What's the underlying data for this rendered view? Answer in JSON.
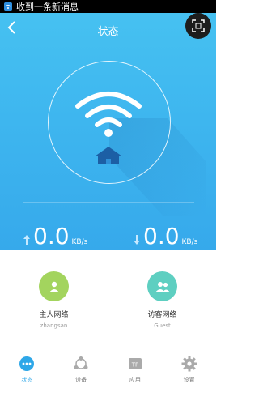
{
  "statusbar": {
    "notification": "收到一条新消息"
  },
  "header": {
    "title": "状态"
  },
  "speed": {
    "upload": {
      "value": "0.0",
      "unit": "KB/s"
    },
    "download": {
      "value": "0.0",
      "unit": "KB/s"
    }
  },
  "networks": [
    {
      "label": "主人网络",
      "sub": "zhangsan",
      "color": "#a3d45e"
    },
    {
      "label": "访客网络",
      "sub": "Guest",
      "color": "#5ecfc1"
    }
  ],
  "tabs": [
    {
      "label": "状态",
      "icon": "status-icon",
      "active": true
    },
    {
      "label": "设备",
      "icon": "devices-icon"
    },
    {
      "label": "应用",
      "icon": "apps-icon"
    },
    {
      "label": "设置",
      "icon": "settings-icon"
    }
  ],
  "colors": {
    "accent": "#2ea7e8",
    "hero": "#3eb6ef"
  }
}
